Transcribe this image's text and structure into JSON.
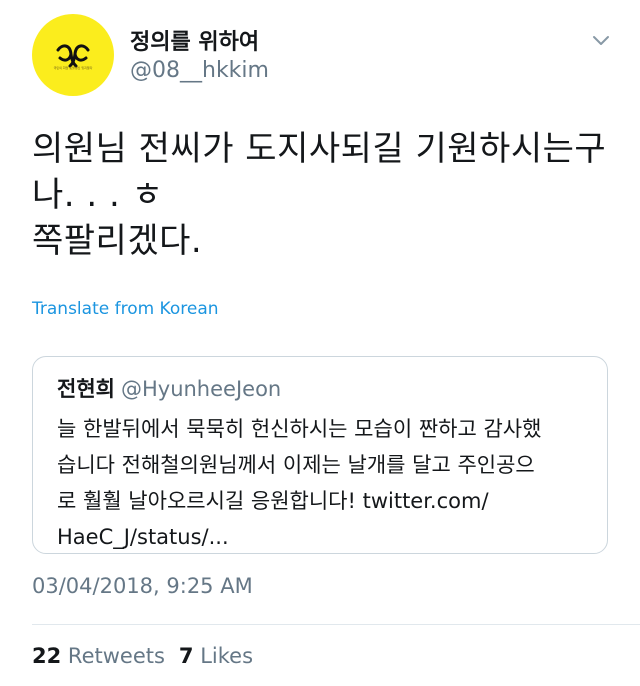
{
  "author": {
    "display_name": "정의를 위하여",
    "handle": "@08__hkkim",
    "avatar_icon": "yellow-ribbon-icon",
    "avatar_caption": "국민의 희망 촛불정신 잊지말자",
    "avatar_color": "#fbed1d"
  },
  "tweet": {
    "text": "의원님 전씨가 도지사되길 기원하시는구\n나. . . ㅎ\n쪽팔리겠다.",
    "translate_label": "Translate from Korean"
  },
  "quoted_tweet": {
    "name": "전현희",
    "handle": "@HyunheeJeon",
    "text": "늘 한발뒤에서 묵묵히 헌신하시는 모습이 짠하고 감사했\n습니다 전해철의원님께서 이제는 날개를 달고 주인공으\n로 훨훨 날아오르시길 응원합니다! twitter.com/\nHaeC_J/status/..."
  },
  "timestamp": "03/04/2018, 9:25 AM",
  "stats": {
    "retweets_count": "22",
    "retweets_label": "Retweets",
    "likes_count": "7",
    "likes_label": "Likes"
  },
  "colors": {
    "link": "#1b95e0",
    "secondary_text": "#657786",
    "border": "#ccd6dd"
  }
}
